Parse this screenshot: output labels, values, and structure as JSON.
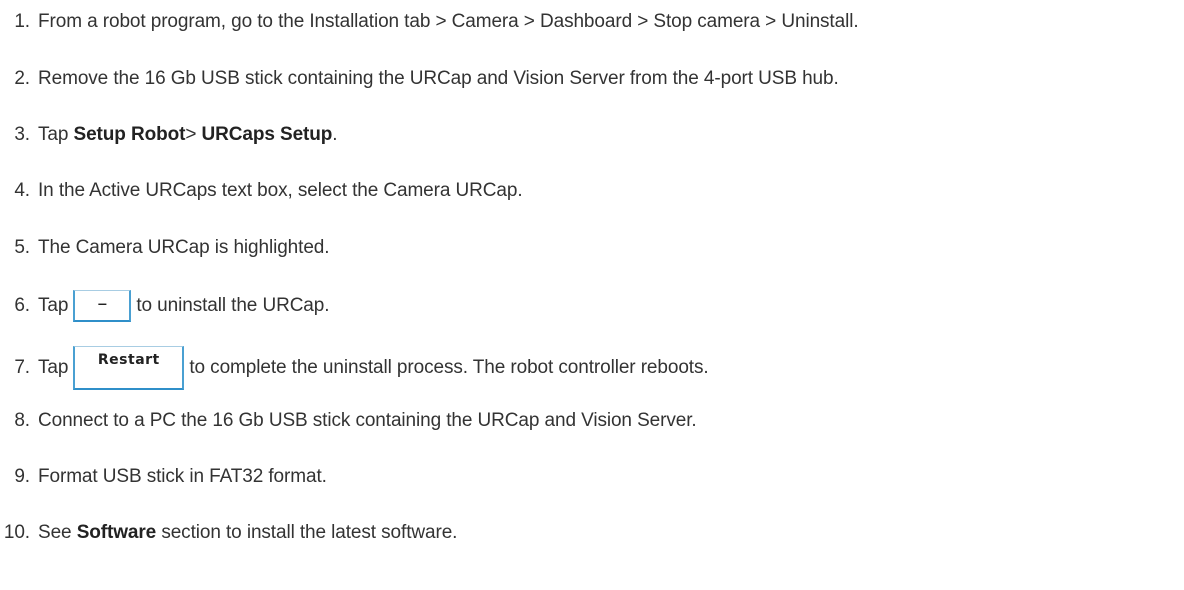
{
  "steps": [
    {
      "num": "1.",
      "text": "From a robot program, go to the Installation tab > Camera > Dashboard > Stop camera > Uninstall."
    },
    {
      "num": "2.",
      "text": "Remove the 16 Gb USB stick containing the URCap and Vision Server from the 4-port USB hub."
    },
    {
      "num": "3.",
      "pre": "Tap ",
      "bold1": "Setup Robot",
      "mid": "> ",
      "bold2": "URCaps Setup",
      "post": "."
    },
    {
      "num": "4.",
      "text": "In the Active URCaps text box, select the Camera URCap."
    },
    {
      "num": "5.",
      "text": "The Camera URCap is highlighted."
    },
    {
      "num": "6.",
      "pre": "Tap",
      "button": "–",
      "post": "to uninstall the URCap."
    },
    {
      "num": "7.",
      "pre": "Tap",
      "button": "Restart",
      "post": "to complete the uninstall process. The robot controller reboots."
    },
    {
      "num": "8.",
      "text": "Connect to a PC the 16 Gb USB stick containing the URCap and Vision Server."
    },
    {
      "num": "9.",
      "text": "Format USB stick in FAT32 format."
    },
    {
      "num": "10.",
      "pre": "See ",
      "bold1": "Software",
      "post": " section to install the latest software."
    }
  ]
}
